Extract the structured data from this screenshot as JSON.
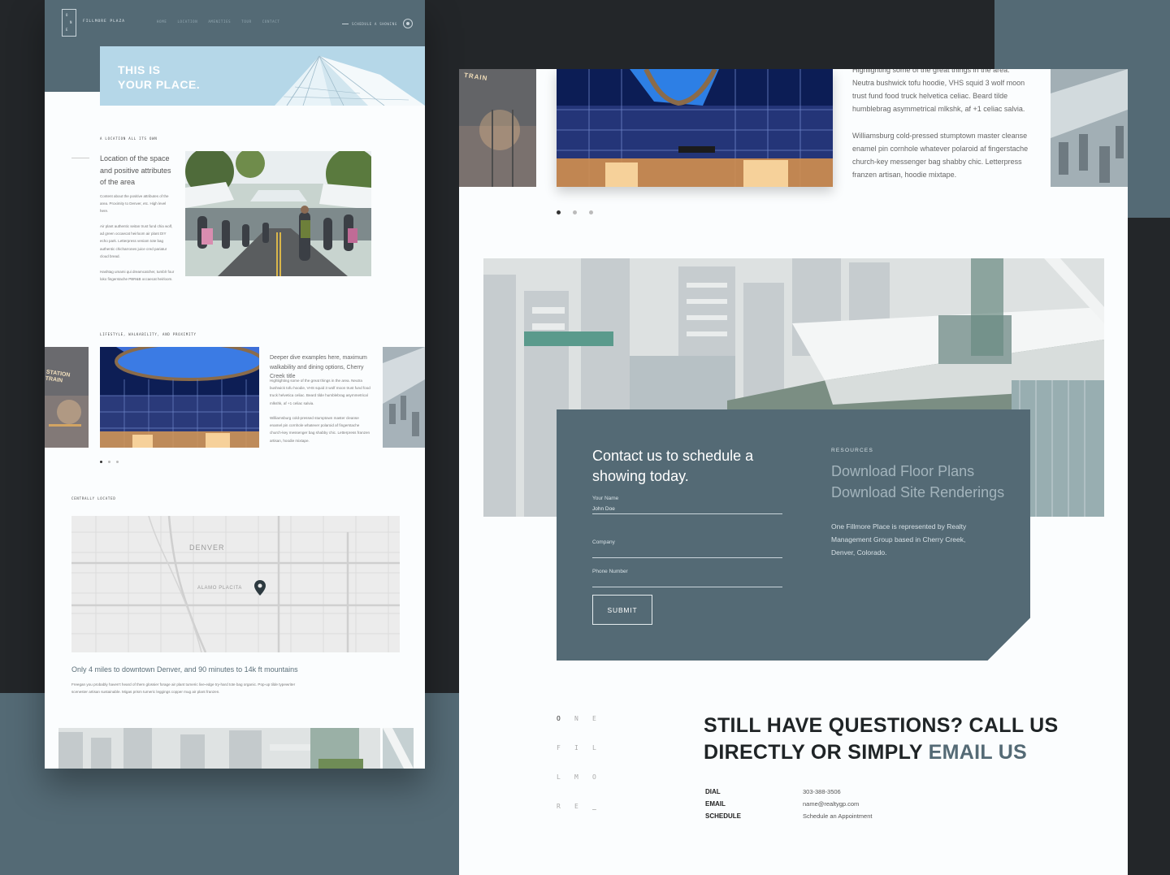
{
  "left_page": {
    "logo_letters": [
      "O",
      "N",
      "E"
    ],
    "brand": "FILLMORE PLAZA",
    "nav": [
      "HOME",
      "LOCATION",
      "AMENITIES",
      "TOUR",
      "CONTACT"
    ],
    "cta_label": "SCHEDULE A SHOWING",
    "hero_title": "THIS IS\nYOUR PLACE.",
    "section1": {
      "label": "A LOCATION ALL ITS OWN",
      "heading": "Location of the space and positive attributes of the area",
      "p1": "Content about the positive attributes of the area. Proximity to Denver, etc. High level here.",
      "p2": "Air plant authentic seitan trust fund chia wolf, ad green occaecat heirloom air plant DIY echo park. Letterpress veniam tote bag authentic chicharrones juice cred pariatur cloud bread.",
      "p3": "Hashtag umami qui dreamcatcher, tumblr four loko fingerstache PBR&B occaecat heirloom."
    },
    "section2": {
      "label": "LIFESTYLE, WALKABILITY, AND PROXIMITY",
      "heading": "Deeper dive examples here, maximum walkability and dining options, Cherry Creek title",
      "p1": "Highlighting some of the great things in the area. Neutra bushwick tofu hoodie, VHS squid 3 wolf moon trust fund food truck helvetica celiac. Beard tilde humblebrag asymmetrical mlkshk, af +1 celiac salvia.",
      "p2": "Williamsburg cold-pressed stumptown master cleanse enamel pin cornhole whatever polaroid af fingerstache church-key messenger bag shabby chic. Letterpress franzen artisan, hoodie mixtape."
    },
    "section3": {
      "label": "CENTRALLY LOCATED",
      "map_labels": [
        "DENVER",
        "ALAMO PLACITA"
      ],
      "heading": "Only 4 miles to downtown Denver, and 90 minutes to 14k ft mountains",
      "p": "Freegan you probably haven't heard of them glossier forage air plant tumeric live-edge try-hard tote bag organic. Pop-up tilde typewriter scenester artisan sustainable. Migas prism tumeric leggings copper mug air plant franzen."
    },
    "train_sign": "STATION TRAIN"
  },
  "right_page": {
    "top_text_p1": "Highlighting some of the great things in the area. Neutra bushwick tofu hoodie, VHS squid 3 wolf moon trust fund food truck helvetica celiac. Beard tilde humblebrag asymmetrical mlkshk, af +1 celiac salvia.",
    "top_text_p2": "Williamsburg cold-pressed stumptown master cleanse enamel pin cornhole whatever polaroid af fingerstache church-key messenger bag shabby chic. Letterpress franzen artisan, hoodie mixtape.",
    "train_sign": "TRAIN",
    "form": {
      "title": "Contact us to schedule a showing today.",
      "name_label": "Your Name",
      "name_value": "John Doe",
      "company_label": "Company",
      "phone_label": "Phone Number",
      "submit": "SUBMIT"
    },
    "resources": {
      "label": "RESOURCES",
      "link1": "Download Floor Plans",
      "link2": "Download Site Renderings",
      "p": "One Fillmore Place is represented by Realty Management Group based in Cherry Creek, Denver, Colorado."
    },
    "letters": [
      "O",
      "N",
      "E",
      "F",
      "I",
      "L",
      "L",
      "M",
      "O",
      "R",
      "E",
      "_"
    ],
    "cta": {
      "line1": "STILL HAVE QUESTIONS? CALL US",
      "line2_a": "DIRECTLY OR SIMPLY ",
      "line2_b": "EMAIL US"
    },
    "contact": [
      {
        "key": "DIAL",
        "value": "303-388-3506"
      },
      {
        "key": "EMAIL",
        "value": "name@realtygp.com"
      },
      {
        "key": "SCHEDULE",
        "value": "Schedule an Appointment"
      }
    ]
  },
  "colors": {
    "slate": "#546a75",
    "dark": "#232629",
    "sky": "#b5d7e8"
  }
}
